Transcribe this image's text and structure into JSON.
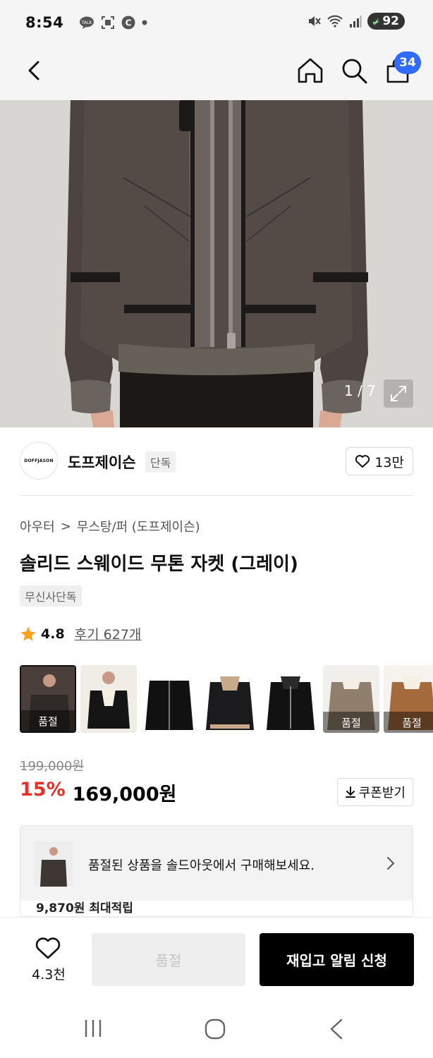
{
  "status_bar": {
    "time": "8:54",
    "battery": "92",
    "left_icons": [
      "talk-icon",
      "screenshot-icon",
      "c-icon",
      "dot-icon"
    ],
    "right_icons": [
      "mute-icon",
      "wifi-icon",
      "signal-icon",
      "battery-icon"
    ]
  },
  "header": {
    "cart_count": "34"
  },
  "gallery": {
    "counter": "1 / 7"
  },
  "brand": {
    "logo_text": "DOFFJASON",
    "name": "도프제이슨",
    "tag": "단독",
    "likes": "13만"
  },
  "breadcrumb": {
    "category": "아우터",
    "separator": ">",
    "subcategory": "무스탕/퍼 (도프제이슨)"
  },
  "product": {
    "title": "솔리드 스웨이드 무톤 자켓 (그레이)",
    "exclusive_badge": "무신사단독",
    "rating": "4.8",
    "review_label": "후기 627개"
  },
  "variants": [
    {
      "label": "품절",
      "colors": [
        "#4a3f3a",
        "#2f2a28"
      ],
      "selected": true
    },
    {
      "label": "",
      "colors": [
        "#f0ece6",
        "#151515"
      ],
      "selected": false
    },
    {
      "label": "",
      "colors": [
        "#ffffff",
        "#111111"
      ],
      "selected": false
    },
    {
      "label": "",
      "colors": [
        "#ffffff",
        "#1b1b1d"
      ],
      "selected": false
    },
    {
      "label": "",
      "colors": [
        "#ffffff",
        "#121212"
      ],
      "selected": false
    },
    {
      "label": "품절",
      "colors": [
        "#f2f0ec",
        "#8f7f6c"
      ],
      "selected": false
    },
    {
      "label": "품절",
      "colors": [
        "#f6f3ee",
        "#a56b3d"
      ],
      "selected": false
    }
  ],
  "pricing": {
    "original": "199,000원",
    "discount": "15%",
    "sale": "169,000원",
    "coupon_label": "쿠폰받기"
  },
  "soldout_banner": {
    "text": "품절된 상품을 솔드아웃에서 구매해보세요."
  },
  "points": {
    "text": "9,870원 최대적립"
  },
  "bottom_bar": {
    "wish_count": "4.3천",
    "soldout_label": "품절",
    "restock_label": "재입고 알림 신청"
  },
  "colors": {
    "accent_blue": "#2f6bff",
    "discount_red": "#e3322b",
    "star_orange": "#ff9f1a",
    "cta_black": "#000000"
  }
}
